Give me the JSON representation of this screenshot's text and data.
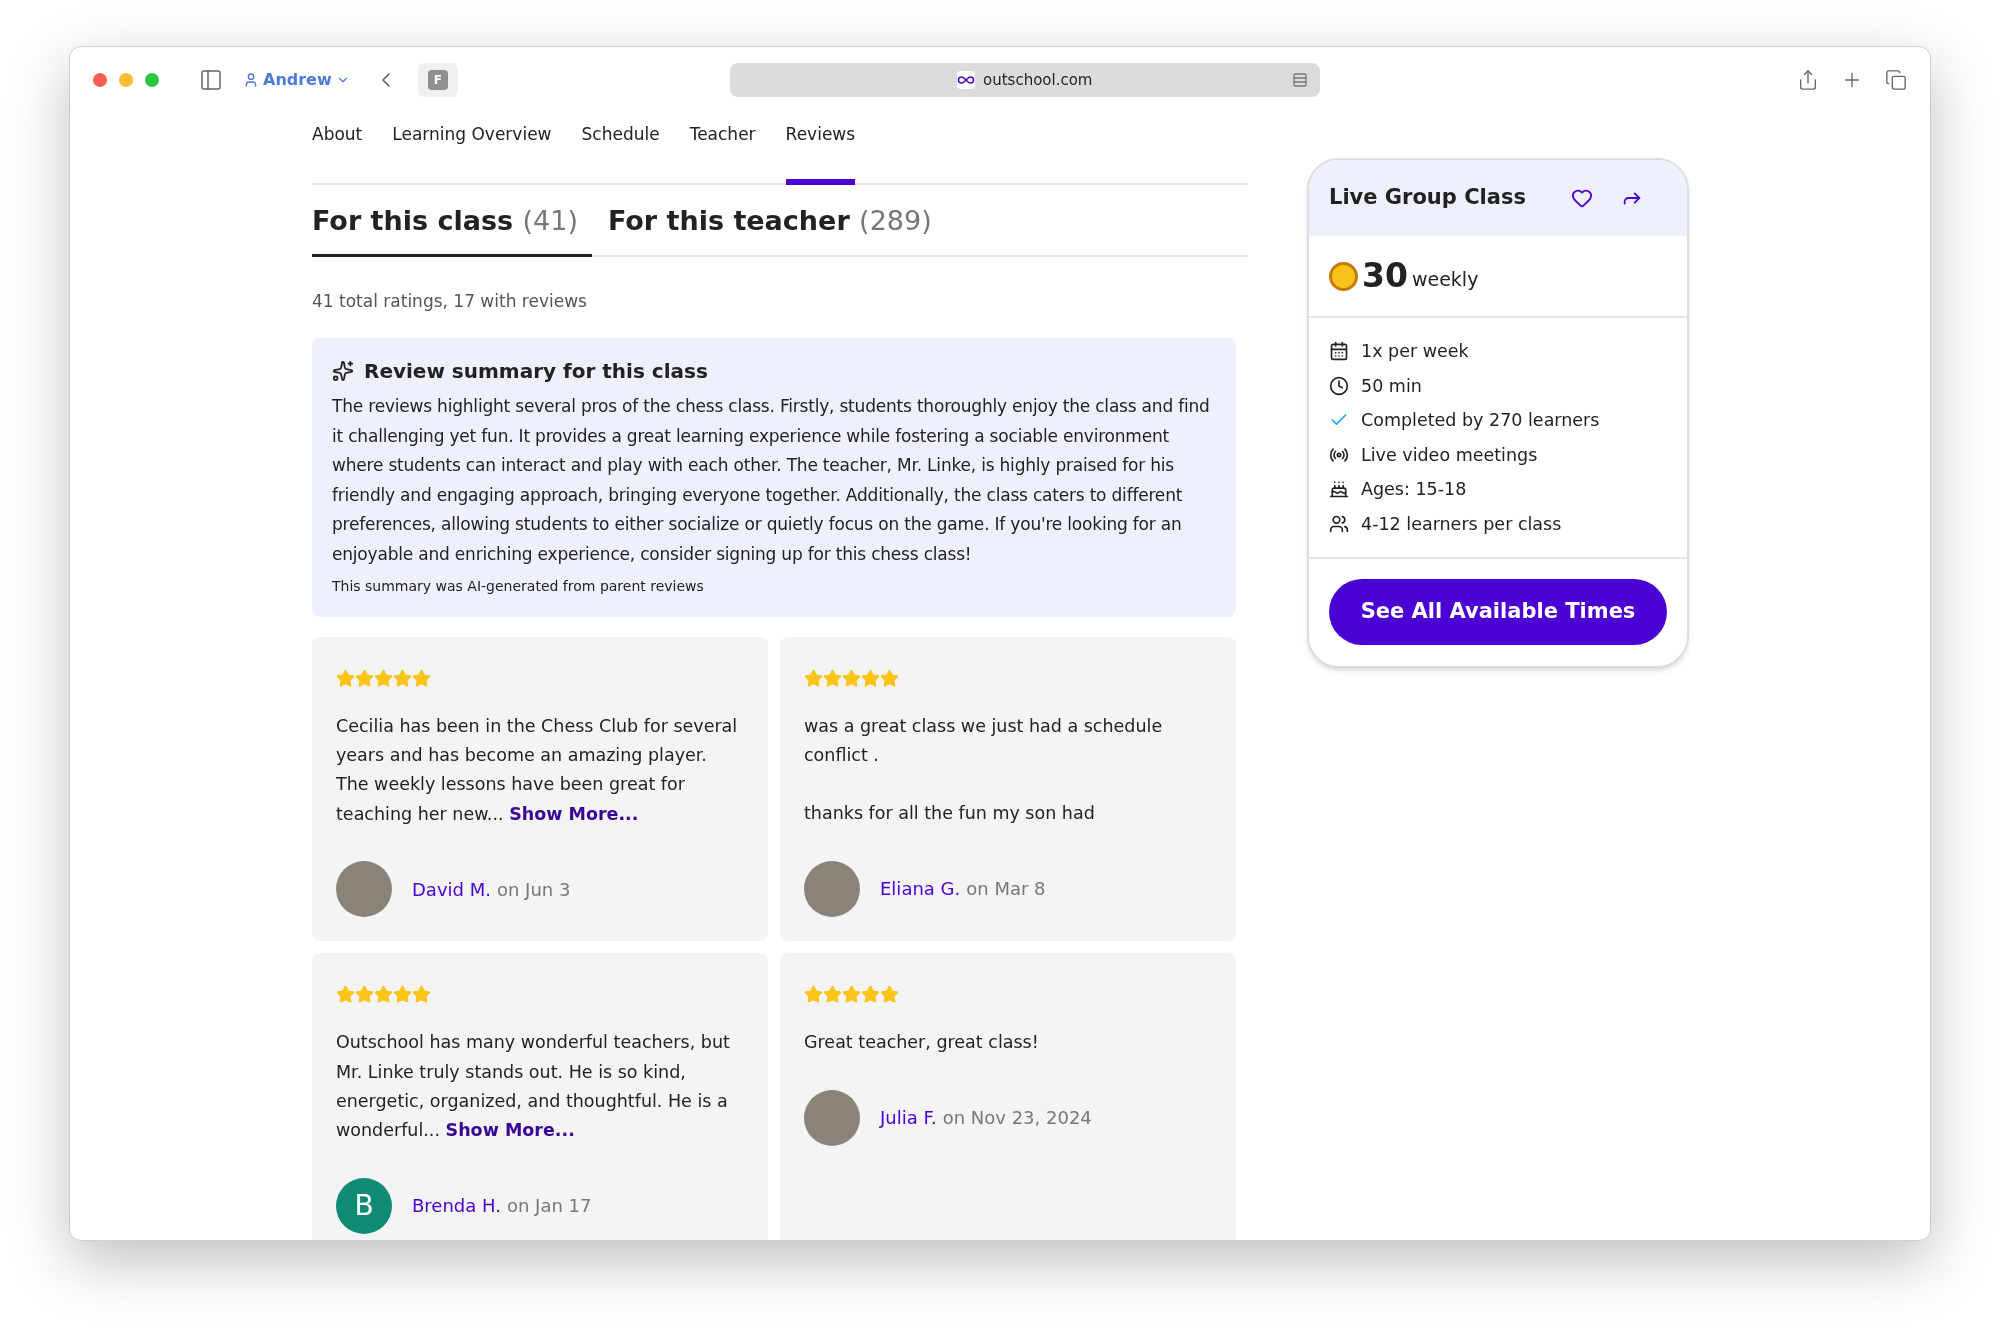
{
  "browser": {
    "profile": "Andrew",
    "tab_letter": "F",
    "url": "outschool.com"
  },
  "nav_tabs": [
    {
      "label": "About",
      "selected": false
    },
    {
      "label": "Learning Overview",
      "selected": false
    },
    {
      "label": "Schedule",
      "selected": false
    },
    {
      "label": "Teacher",
      "selected": false
    },
    {
      "label": "Reviews",
      "selected": true
    }
  ],
  "review_tabs": [
    {
      "label": "For this class",
      "count": "(41)",
      "selected": true
    },
    {
      "label": "For this teacher",
      "count": "(289)",
      "selected": false
    }
  ],
  "ratings_summary": "41 total ratings, 17 with reviews",
  "ai_summary": {
    "title": "Review summary for this class",
    "text": "The reviews highlight several pros of the chess class. Firstly, students thoroughly enjoy the class and find it challenging yet fun. It provides a great learning experience while fostering a sociable environment where students can interact and play with each other. The teacher, Mr. Linke, is highly praised for his friendly and engaging approach, bringing everyone together. Additionally, the class caters to different preferences, allowing students to either socialize or quietly focus on the game. If you're looking for an enjoyable and enriching experience, consider signing up for this chess class!",
    "note": "This summary was AI-generated from parent reviews"
  },
  "reviews": [
    {
      "stars": 5,
      "paragraphs": [
        "Cecilia has been in the Chess Club for several years and has become an amazing player. The weekly lessons have been great for teaching her new..."
      ],
      "more_link": "Show More...",
      "avatar": {
        "kind": "photo"
      },
      "author": "David M.",
      "date": "on Jun 3"
    },
    {
      "stars": 5,
      "paragraphs": [
        "was a great class we just had a schedule conflict .",
        "thanks for all the fun my son had"
      ],
      "avatar": {
        "kind": "photo"
      },
      "author": "Eliana G.",
      "date": "on Mar 8"
    },
    {
      "stars": 5,
      "paragraphs": [
        "Outschool has many wonderful teachers,  but Mr. Linke truly stands out. He is so kind, energetic, organized, and thoughtful. He is a wonderful..."
      ],
      "more_link": "Show More...",
      "avatar": {
        "kind": "initial",
        "initial": "B"
      },
      "author": "Brenda H.",
      "date": "on Jan 17"
    },
    {
      "stars": 5,
      "paragraphs": [
        "Great teacher, great class!"
      ],
      "avatar": {
        "kind": "photo"
      },
      "author": "Julia F.",
      "date": "on Nov 23, 2024"
    }
  ],
  "class_card": {
    "title": "Live Group Class",
    "price": "30",
    "period": "weekly",
    "details": [
      {
        "kind": "calendar",
        "text": "1x per week"
      },
      {
        "kind": "clock",
        "text": "50 min"
      },
      {
        "kind": "check",
        "text": "Completed by 270 learners"
      },
      {
        "kind": "live",
        "text": "Live video meetings"
      },
      {
        "kind": "cake",
        "text": "Ages: 15-18"
      },
      {
        "kind": "group",
        "text": "4-12 learners per class"
      }
    ],
    "button": "See All Available Times"
  }
}
